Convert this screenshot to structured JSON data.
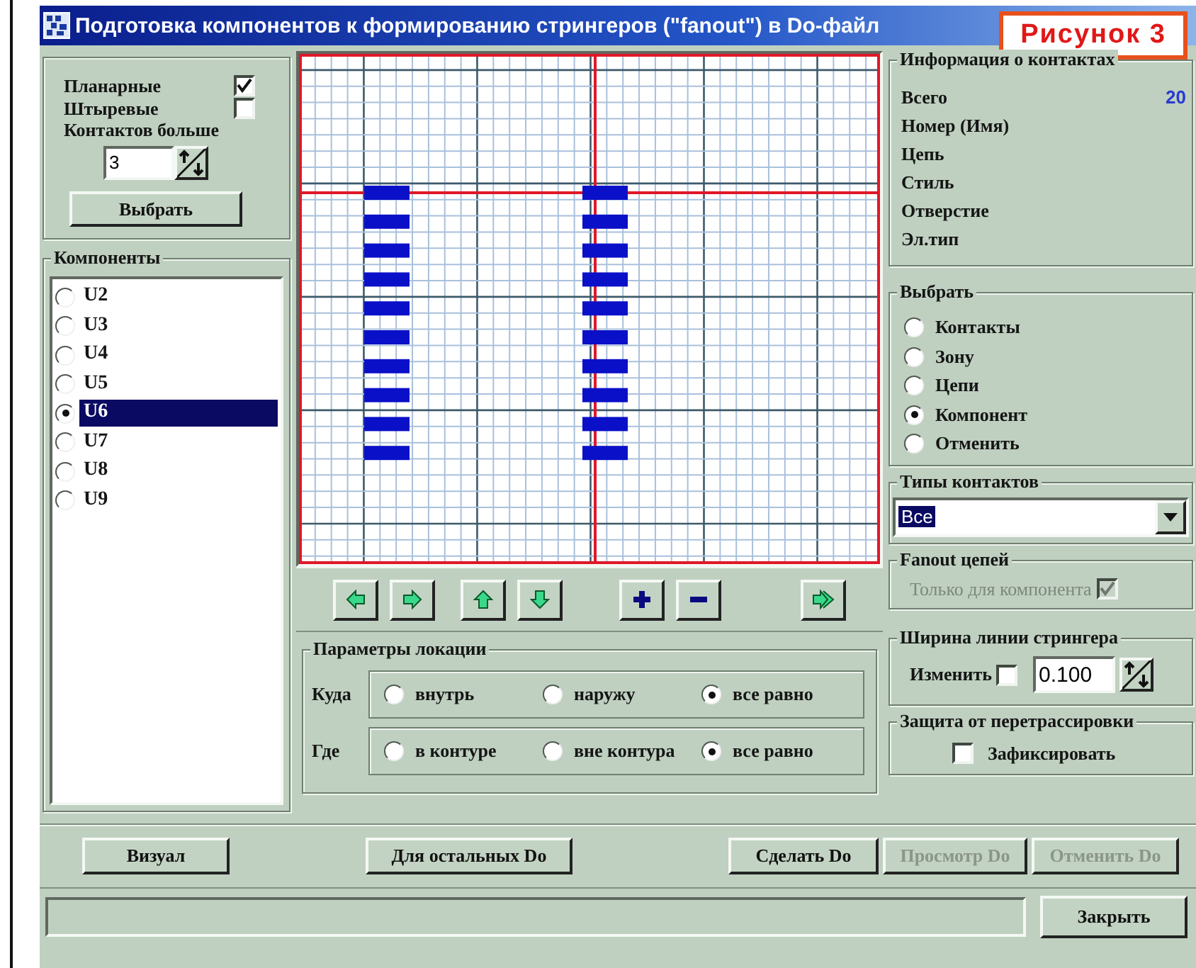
{
  "window": {
    "title": "Подготовка компонентов к формированию стрингеров (\"fanout\") в Do-файл"
  },
  "figure_label": "Рисунок 3",
  "filter": {
    "options": [
      {
        "label": "Планарные",
        "checked": true
      },
      {
        "label": "Штыревые",
        "checked": false
      }
    ],
    "min_pins_label": "Контактов больше",
    "min_pins_value": "3",
    "button": "Выбрать"
  },
  "components": {
    "title": "Компоненты",
    "items": [
      {
        "label": "U2",
        "selected": false
      },
      {
        "label": "U3",
        "selected": false
      },
      {
        "label": "U4",
        "selected": false
      },
      {
        "label": "U5",
        "selected": false
      },
      {
        "label": "U6",
        "selected": true
      },
      {
        "label": "U7",
        "selected": false
      },
      {
        "label": "U8",
        "selected": false
      },
      {
        "label": "U9",
        "selected": false
      }
    ]
  },
  "location": {
    "title": "Параметры локации",
    "rows": [
      {
        "label": "Куда",
        "options": [
          {
            "label": "внутрь",
            "selected": false
          },
          {
            "label": "наружу",
            "selected": false
          },
          {
            "label": "все равно",
            "selected": true
          }
        ]
      },
      {
        "label": "Где",
        "options": [
          {
            "label": "в контуре",
            "selected": false
          },
          {
            "label": "вне контура",
            "selected": false
          },
          {
            "label": "все равно",
            "selected": true
          }
        ]
      }
    ]
  },
  "contact_info": {
    "title": "Информация о контактах",
    "rows": [
      {
        "label": "Всего",
        "value": "20"
      },
      {
        "label": "Номер (Имя)"
      },
      {
        "label": "Цепь"
      },
      {
        "label": "Стиль"
      },
      {
        "label": "Отверстие"
      },
      {
        "label": "Эл.тип"
      }
    ]
  },
  "select": {
    "title": "Выбрать",
    "options": [
      {
        "label": "Контакты",
        "selected": false
      },
      {
        "label": "Зону",
        "selected": false
      },
      {
        "label": "Цепи",
        "selected": false
      },
      {
        "label": "Компонент",
        "selected": true
      },
      {
        "label": "Отменить",
        "selected": false
      }
    ]
  },
  "contact_types": {
    "title": "Типы контактов",
    "value": "Все"
  },
  "fanout": {
    "title": "Fanout цепей",
    "option": {
      "label": "Только для компонента",
      "checked": true,
      "disabled": true
    }
  },
  "line_width": {
    "title": "Ширина линии стрингера",
    "change": {
      "label": "Изменить",
      "checked": false
    },
    "value": "0.100"
  },
  "protection": {
    "title": "Защита от перетрассировки",
    "option": {
      "label": "Зафиксировать",
      "checked": false
    }
  },
  "actions": [
    {
      "label": "Визуал",
      "disabled": false
    },
    {
      "label": "Для остальных Do",
      "disabled": false
    },
    {
      "label": "Сделать Do",
      "disabled": false
    },
    {
      "label": "Просмотр Do",
      "disabled": true
    },
    {
      "label": "Отменить Do",
      "disabled": true
    }
  ],
  "close_button": "Закрыть"
}
